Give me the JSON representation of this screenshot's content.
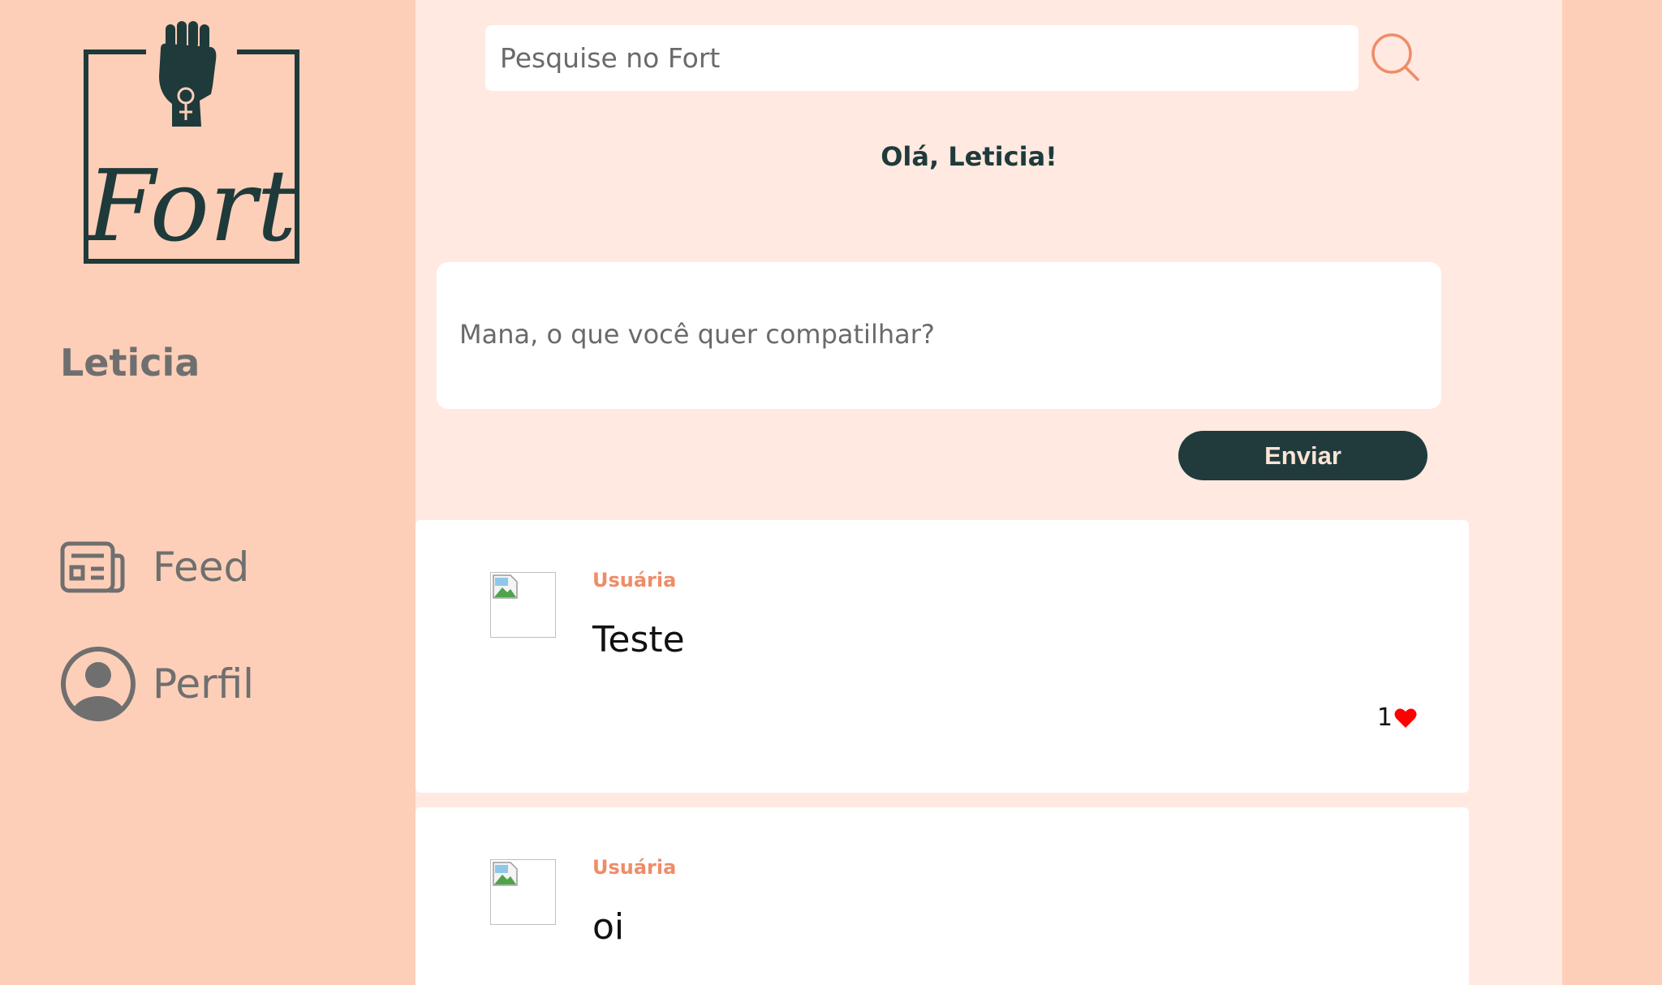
{
  "app": {
    "name": "Fort"
  },
  "sidebar": {
    "username": "Leticia",
    "nav": [
      {
        "label": "Feed",
        "icon": "newspaper-icon"
      },
      {
        "label": "Perfil",
        "icon": "user-circle-icon"
      }
    ]
  },
  "header": {
    "search_placeholder": "Pesquise no Fort",
    "greeting": "Olá, Leticia!"
  },
  "composer": {
    "placeholder": "Mana, o que você quer compatilhar?",
    "send_label": "Enviar"
  },
  "posts": [
    {
      "author": "Usuária",
      "text": "Teste",
      "likes": "1",
      "avatar": "broken-image-icon"
    },
    {
      "author": "Usuária",
      "text": "oi",
      "avatar": "broken-image-icon"
    }
  ],
  "colors": {
    "sidebar_bg": "#fecfb8",
    "main_bg": "#ffe9e1",
    "dark_teal": "#213b3c",
    "author_orange": "#ef8c68",
    "like_red": "#ff0000"
  }
}
